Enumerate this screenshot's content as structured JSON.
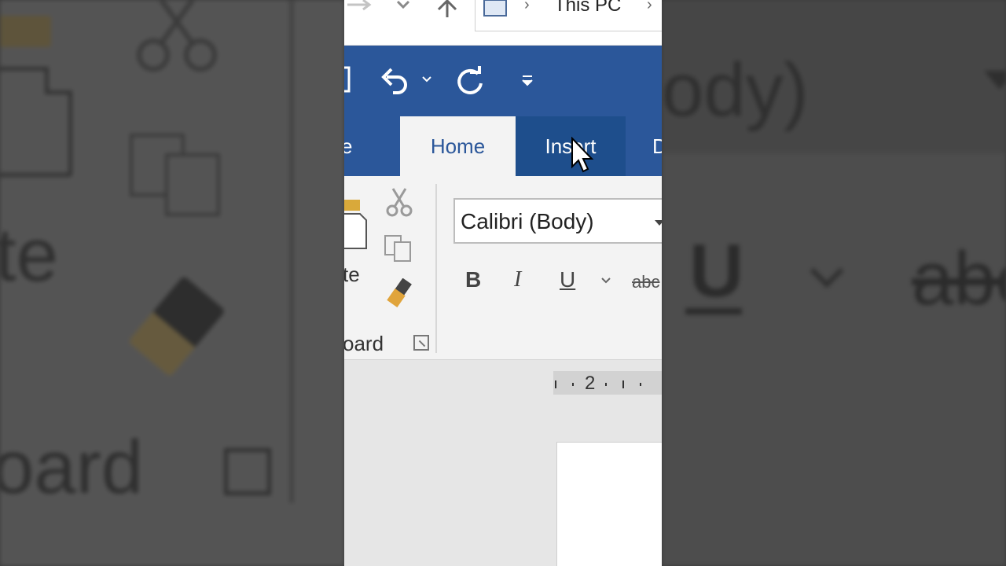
{
  "background": {
    "paste_fragment": "te",
    "clipboard_fragment": "oard",
    "font_fragment": "ody)",
    "underline_glyph": "U",
    "strikethrough_glyph": "abe"
  },
  "explorer": {
    "back_icon": "left-arrow-icon",
    "up_icon": "up-arrow-icon",
    "breadcrumb": "This PC",
    "breadcrumb_sep": "›"
  },
  "quick_access": {
    "save_icon": "save-icon",
    "undo_icon": "undo-icon",
    "redo_icon": "redo-icon",
    "customize_icon": "customize-quick-access-icon"
  },
  "tabs": {
    "left_partial": "e",
    "home": "Home",
    "insert": "Insert",
    "right_partial": "D"
  },
  "ribbon": {
    "paste_label": "te",
    "clipboard_label": "oard",
    "font_name": "Calibri (Body)",
    "bold": "B",
    "italic": "I",
    "underline": "U",
    "strikethrough": "abc"
  },
  "ruler": {
    "marker": "2"
  },
  "colors": {
    "word_blue": "#2b579a",
    "tab_hover": "#1e4e8c",
    "ribbon_bg": "#f3f3f3"
  }
}
